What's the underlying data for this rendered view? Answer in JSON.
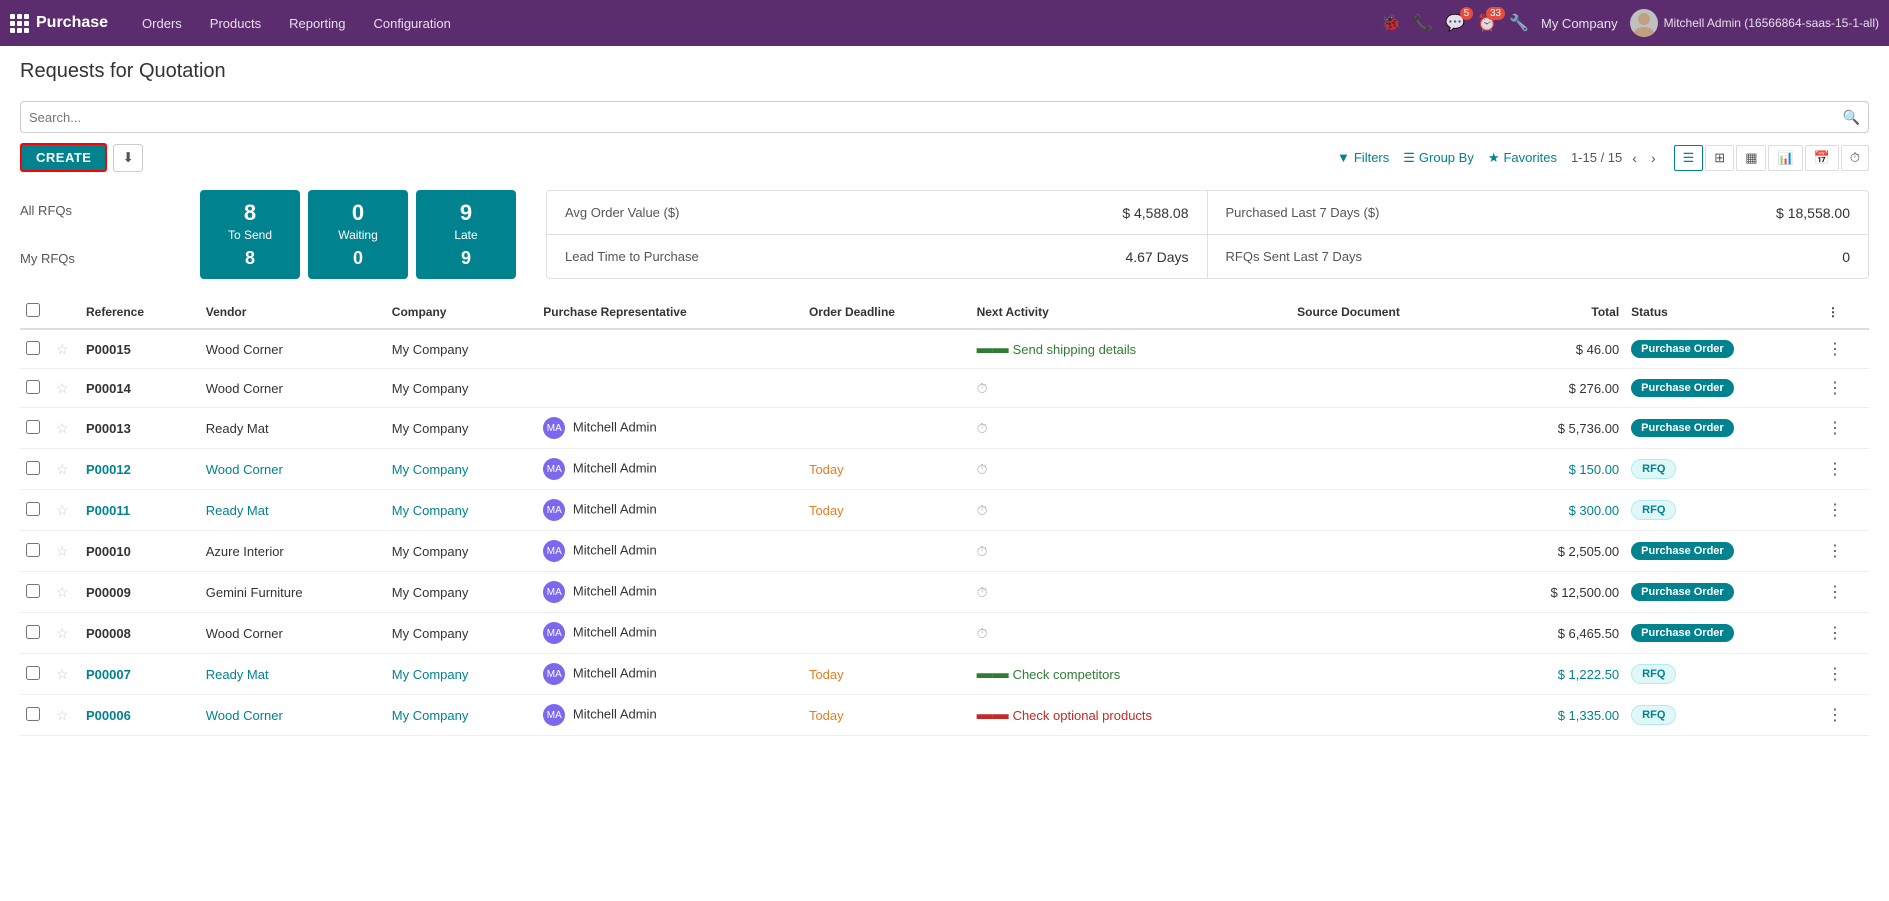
{
  "topnav": {
    "brand": "Purchase",
    "menu": [
      "Orders",
      "Products",
      "Reporting",
      "Configuration"
    ],
    "company": "My Company",
    "user": "Mitchell Admin (16566864-saas-15-1-all)",
    "chat_badge": "5",
    "activity_badge": "33"
  },
  "page": {
    "title": "Requests for Quotation"
  },
  "toolbar": {
    "create_label": "CREATE",
    "search_placeholder": "Search..."
  },
  "filters": {
    "filters_label": "Filters",
    "groupby_label": "Group By",
    "favorites_label": "Favorites",
    "pagination": "1-15 / 15"
  },
  "stats": {
    "all_rfqs_label": "All RFQs",
    "my_rfqs_label": "My RFQs",
    "cards": [
      {
        "top": "8",
        "top_label": "To Send",
        "bottom": "8",
        "bottom_label": ""
      },
      {
        "top": "0",
        "top_label": "Waiting",
        "bottom": "0",
        "bottom_label": ""
      },
      {
        "top": "9",
        "top_label": "Late",
        "bottom": "9",
        "bottom_label": ""
      }
    ],
    "kpis": [
      {
        "label": "Avg Order Value ($)",
        "value": "$ 4,588.08"
      },
      {
        "label": "Purchased Last 7 Days ($)",
        "value": "$ 18,558.00"
      },
      {
        "label": "Lead Time to Purchase",
        "value": "4.67  Days"
      },
      {
        "label": "RFQs Sent Last 7 Days",
        "value": "0"
      }
    ]
  },
  "table": {
    "columns": [
      "",
      "",
      "Reference",
      "Vendor",
      "Company",
      "Purchase Representative",
      "Order Deadline",
      "Next Activity",
      "Source Document",
      "Total",
      "Status",
      ""
    ],
    "rows": [
      {
        "id": "P00015",
        "vendor": "Wood Corner",
        "company": "My Company",
        "rep": "",
        "deadline": "",
        "activity": "Send shipping details",
        "activity_icon": "green",
        "source": "",
        "total": "$ 46.00",
        "total_style": "normal",
        "status": "Purchase Order",
        "status_style": "po",
        "ref_style": "normal"
      },
      {
        "id": "P00014",
        "vendor": "Wood Corner",
        "company": "My Company",
        "rep": "",
        "deadline": "",
        "activity": "",
        "activity_icon": "gray",
        "source": "",
        "total": "$ 276.00",
        "total_style": "normal",
        "status": "Purchase Order",
        "status_style": "po",
        "ref_style": "normal"
      },
      {
        "id": "P00013",
        "vendor": "Ready Mat",
        "company": "My Company",
        "rep": "Mitchell Admin",
        "deadline": "",
        "activity": "",
        "activity_icon": "gray",
        "source": "",
        "total": "$ 5,736.00",
        "total_style": "normal",
        "status": "Purchase Order",
        "status_style": "po",
        "ref_style": "normal"
      },
      {
        "id": "P00012",
        "vendor": "Wood Corner",
        "company": "My Company",
        "rep": "Mitchell Admin",
        "deadline": "Today",
        "activity": "",
        "activity_icon": "gray",
        "source": "",
        "total": "$ 150.00",
        "total_style": "blue",
        "status": "RFQ",
        "status_style": "rfq",
        "ref_style": "blue"
      },
      {
        "id": "P00011",
        "vendor": "Ready Mat",
        "company": "My Company",
        "rep": "Mitchell Admin",
        "deadline": "Today",
        "activity": "",
        "activity_icon": "gray",
        "source": "",
        "total": "$ 300.00",
        "total_style": "blue",
        "status": "RFQ",
        "status_style": "rfq",
        "ref_style": "blue"
      },
      {
        "id": "P00010",
        "vendor": "Azure Interior",
        "company": "My Company",
        "rep": "Mitchell Admin",
        "deadline": "",
        "activity": "",
        "activity_icon": "gray",
        "source": "",
        "total": "$ 2,505.00",
        "total_style": "normal",
        "status": "Purchase Order",
        "status_style": "po",
        "ref_style": "normal"
      },
      {
        "id": "P00009",
        "vendor": "Gemini Furniture",
        "company": "My Company",
        "rep": "Mitchell Admin",
        "deadline": "",
        "activity": "",
        "activity_icon": "gray",
        "source": "",
        "total": "$ 12,500.00",
        "total_style": "normal",
        "status": "Purchase Order",
        "status_style": "po",
        "ref_style": "normal"
      },
      {
        "id": "P00008",
        "vendor": "Wood Corner",
        "company": "My Company",
        "rep": "Mitchell Admin",
        "deadline": "",
        "activity": "",
        "activity_icon": "gray",
        "source": "",
        "total": "$ 6,465.50",
        "total_style": "normal",
        "status": "Purchase Order",
        "status_style": "po",
        "ref_style": "normal"
      },
      {
        "id": "P00007",
        "vendor": "Ready Mat",
        "company": "My Company",
        "rep": "Mitchell Admin",
        "deadline": "Today",
        "activity": "Check competitors",
        "activity_icon": "green",
        "source": "",
        "total": "$ 1,222.50",
        "total_style": "blue",
        "status": "RFQ",
        "status_style": "rfq",
        "ref_style": "blue"
      },
      {
        "id": "P00006",
        "vendor": "Wood Corner",
        "company": "My Company",
        "rep": "Mitchell Admin",
        "deadline": "Today",
        "activity": "Check optional products",
        "activity_icon": "red",
        "source": "",
        "total": "$ 1,335.00",
        "total_style": "blue",
        "status": "RFQ",
        "status_style": "rfq",
        "ref_style": "blue"
      }
    ]
  }
}
